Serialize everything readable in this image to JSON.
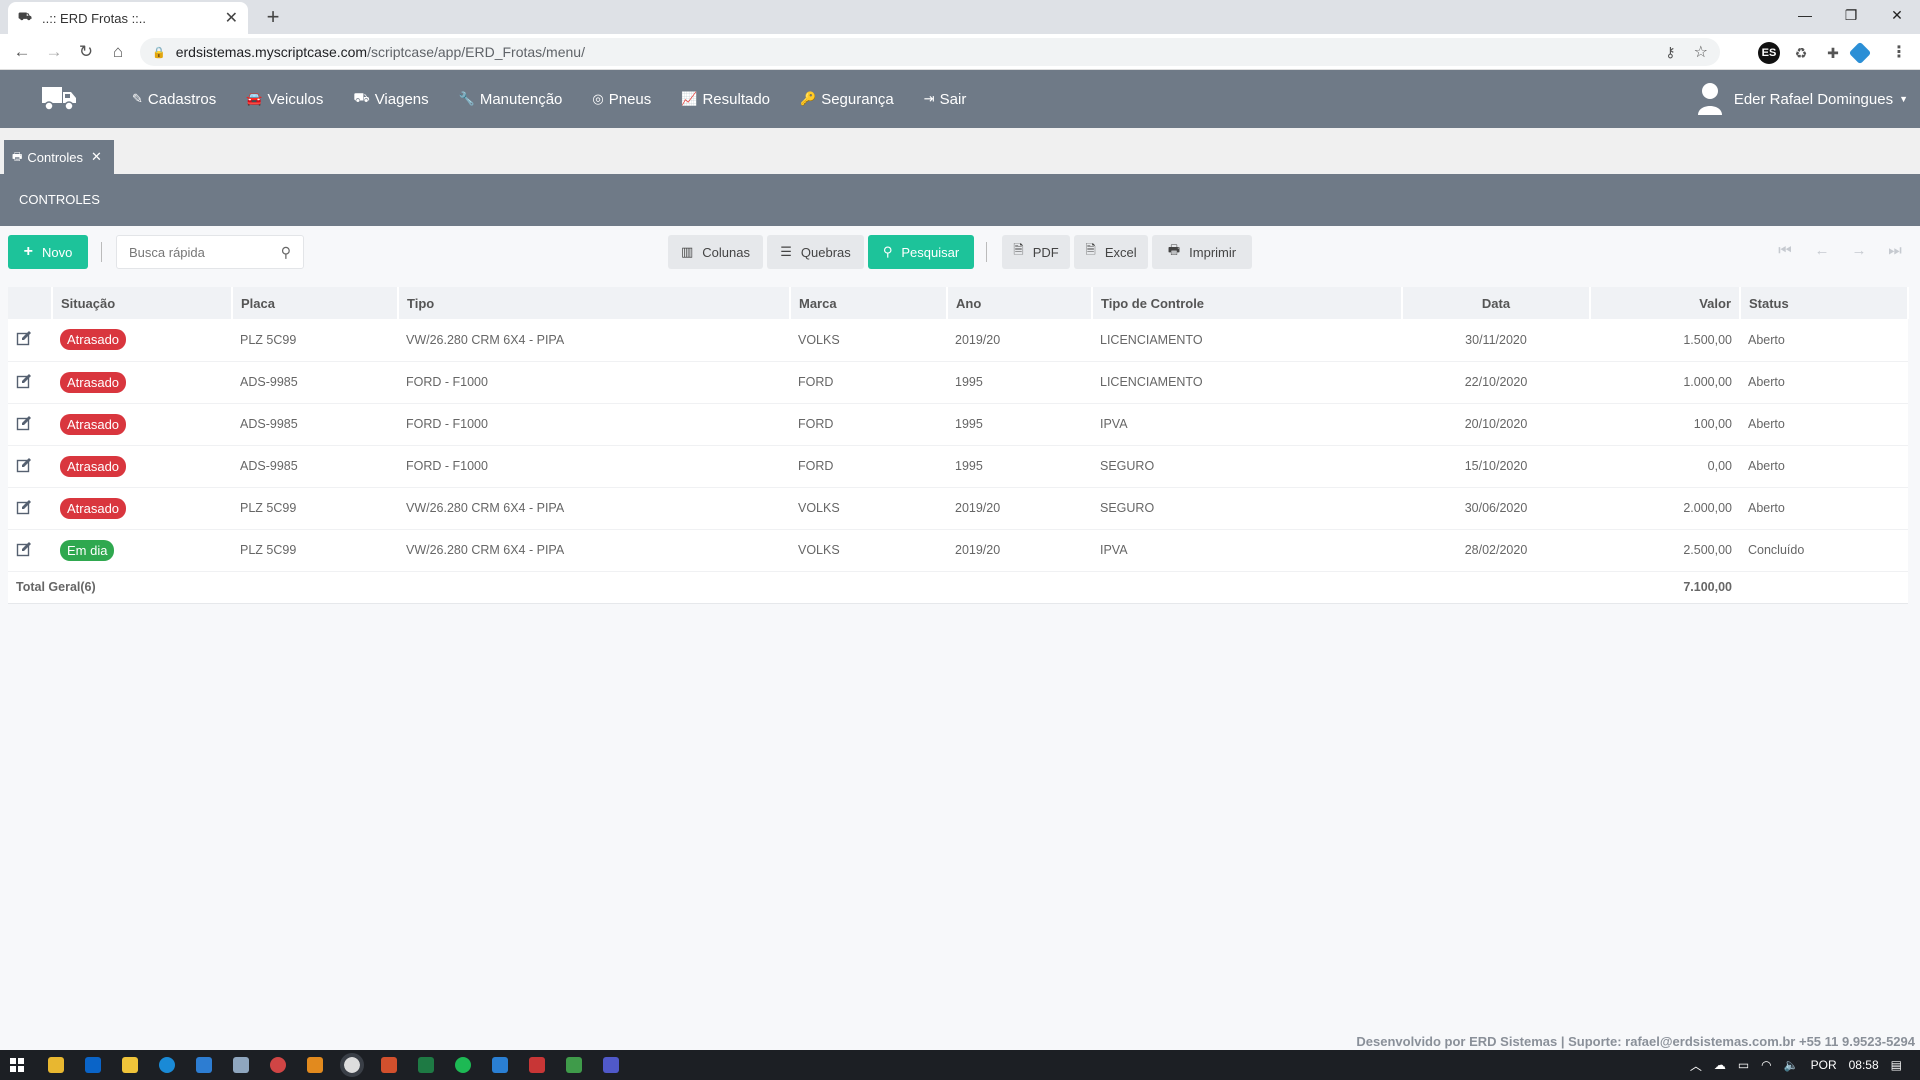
{
  "browser": {
    "tab_title": "..:: ERD Frotas ::..",
    "url_host": "erdsistemas.myscriptcase.com",
    "url_path": "/scriptcase/app/ERD_Frotas/menu/"
  },
  "app": {
    "menu": [
      {
        "label": "Cadastros",
        "icon": "edit-icon"
      },
      {
        "label": "Veiculos",
        "icon": "car-icon"
      },
      {
        "label": "Viagens",
        "icon": "truck-icon"
      },
      {
        "label": "Manutenção",
        "icon": "wrench-icon"
      },
      {
        "label": "Pneus",
        "icon": "tire-icon"
      },
      {
        "label": "Resultado",
        "icon": "chart-icon"
      },
      {
        "label": "Segurança",
        "icon": "key-icon"
      },
      {
        "label": "Sair",
        "icon": "sign-out-icon"
      }
    ],
    "user_name": "Eder Rafael Domingues",
    "open_tab": "Controles",
    "section_title": "CONTROLES"
  },
  "toolbar": {
    "new_label": "Novo",
    "search_placeholder": "Busca rápida",
    "columns_label": "Colunas",
    "breaks_label": "Quebras",
    "search_label": "Pesquisar",
    "pdf_label": "PDF",
    "excel_label": "Excel",
    "print_label": "Imprimir"
  },
  "table": {
    "headers": {
      "situacao": "Situação",
      "placa": "Placa",
      "tipo": "Tipo",
      "marca": "Marca",
      "ano": "Ano",
      "tipo_controle": "Tipo de Controle",
      "data": "Data",
      "valor": "Valor",
      "status": "Status"
    },
    "rows": [
      {
        "situacao": "Atrasado",
        "placa": "PLZ 5C99",
        "tipo": "VW/26.280 CRM 6X4 - PIPA",
        "marca": "VOLKS",
        "ano": "2019/20",
        "tipo_controle": "LICENCIAMENTO",
        "data": "30/11/2020",
        "valor": "1.500,00",
        "status": "Aberto"
      },
      {
        "situacao": "Atrasado",
        "placa": "ADS-9985",
        "tipo": "FORD - F1000",
        "marca": "FORD",
        "ano": "1995",
        "tipo_controle": "LICENCIAMENTO",
        "data": "22/10/2020",
        "valor": "1.000,00",
        "status": "Aberto"
      },
      {
        "situacao": "Atrasado",
        "placa": "ADS-9985",
        "tipo": "FORD - F1000",
        "marca": "FORD",
        "ano": "1995",
        "tipo_controle": "IPVA",
        "data": "20/10/2020",
        "valor": "100,00",
        "status": "Aberto"
      },
      {
        "situacao": "Atrasado",
        "placa": "ADS-9985",
        "tipo": "FORD - F1000",
        "marca": "FORD",
        "ano": "1995",
        "tipo_controle": "SEGURO",
        "data": "15/10/2020",
        "valor": "0,00",
        "status": "Aberto"
      },
      {
        "situacao": "Atrasado",
        "placa": "PLZ 5C99",
        "tipo": "VW/26.280 CRM 6X4 - PIPA",
        "marca": "VOLKS",
        "ano": "2019/20",
        "tipo_controle": "SEGURO",
        "data": "30/06/2020",
        "valor": "2.000,00",
        "status": "Aberto"
      },
      {
        "situacao": "Em dia",
        "placa": "PLZ 5C99",
        "tipo": "VW/26.280 CRM 6X4 - PIPA",
        "marca": "VOLKS",
        "ano": "2019/20",
        "tipo_controle": "IPVA",
        "data": "28/02/2020",
        "valor": "2.500,00",
        "status": "Concluído"
      }
    ],
    "total_label": "Total Geral(6)",
    "total_value": "7.100,00"
  },
  "footer": "Desenvolvido por ERD Sistemas | Suporte: rafael@erdsistemas.com.br +55 11 9.9523-5294",
  "taskbar": {
    "language": "POR",
    "time": "08:58"
  },
  "colors": {
    "header_bg": "#6f7a87",
    "accent_green": "#1dc39a",
    "badge_late": "#d9363e",
    "badge_ok": "#2fa84f"
  }
}
